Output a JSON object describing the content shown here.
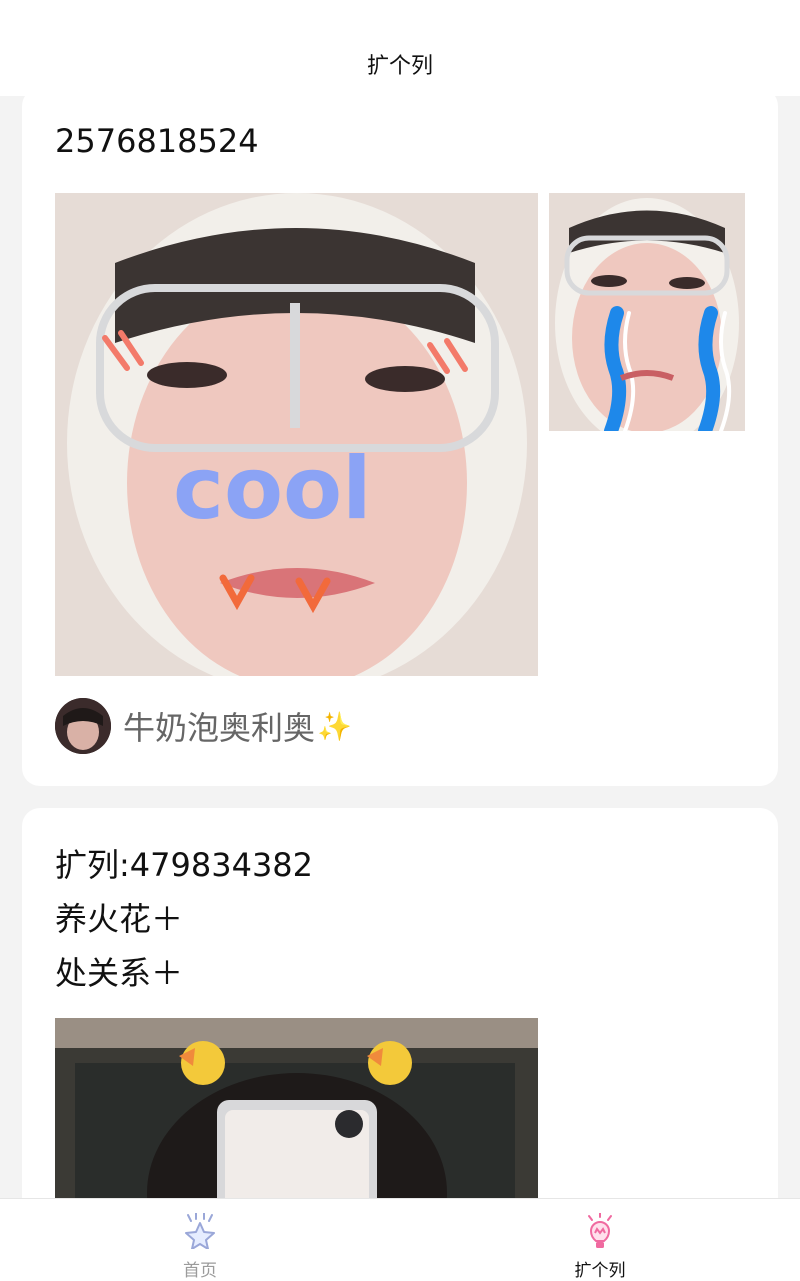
{
  "header": {
    "title": "扩个列"
  },
  "posts": [
    {
      "text_lines": [
        "2576818524"
      ],
      "author": {
        "name": "牛奶泡奥利奥",
        "badge_icon": "sparkle-icon"
      },
      "images": [
        "selfie-photo-cool",
        "selfie-photo-crying"
      ]
    },
    {
      "text_lines": [
        "扩列:479834382",
        "养火花＋",
        "处关系＋"
      ],
      "images": [
        "selfie-photo-duck-headband"
      ]
    }
  ],
  "bottom_nav": {
    "items": [
      {
        "label": "首页",
        "icon": "star-icon",
        "active": false
      },
      {
        "label": "扩个列",
        "icon": "lightbulb-icon",
        "active": true
      }
    ],
    "colors": {
      "active_icon": "#f06aa0",
      "inactive_icon": "#9aa7d8"
    }
  },
  "colors": {
    "background": "#f3f3f3",
    "card": "#ffffff",
    "author_name": "#666666"
  }
}
